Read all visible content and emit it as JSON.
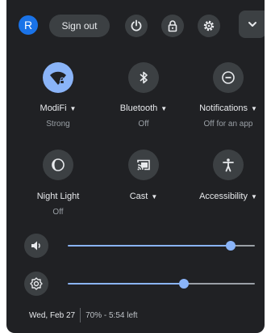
{
  "header": {
    "avatar_letter": "R",
    "sign_out_label": "Sign out",
    "buttons": [
      "power-icon",
      "lock-icon",
      "settings-icon",
      "chevron-down-icon"
    ]
  },
  "tiles": [
    {
      "label": "ModiFi",
      "sub": "Strong",
      "icon": "wifi-icon",
      "active": true,
      "has_menu": true
    },
    {
      "label": "Bluetooth",
      "sub": "Off",
      "icon": "bluetooth-icon",
      "active": false,
      "has_menu": true
    },
    {
      "label": "Notifications",
      "sub": "Off for an app",
      "icon": "notifications-icon",
      "active": false,
      "has_menu": true
    },
    {
      "label": "Night Light",
      "sub": "Off",
      "icon": "night-light-icon",
      "active": false,
      "has_menu": false
    },
    {
      "label": "Cast",
      "sub": "",
      "icon": "cast-icon",
      "active": false,
      "has_menu": true
    },
    {
      "label": "Accessibility",
      "sub": "",
      "icon": "accessibility-icon",
      "active": false,
      "has_menu": true
    }
  ],
  "sliders": {
    "volume": {
      "icon": "volume-icon",
      "level": 0.87
    },
    "brightness": {
      "icon": "brightness-icon",
      "level": 0.62
    }
  },
  "footer": {
    "date": "Wed, Feb 27",
    "battery": "70% - 5:54 left"
  },
  "colors": {
    "panel": "#202124",
    "button": "#3c4043",
    "accent": "#8ab4f8",
    "avatar": "#1a73e8"
  }
}
